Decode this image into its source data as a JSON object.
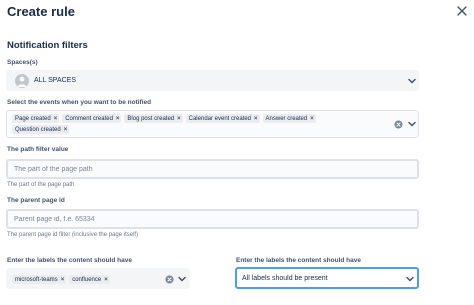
{
  "dialog": {
    "title": "Create rule"
  },
  "filters": {
    "section_title": "Notification filters",
    "spaces": {
      "label": "Spaces(s)",
      "value": "ALL SPACES"
    },
    "events": {
      "label": "Select the events when you want to be notified",
      "selected": [
        "Page created",
        "Comment created",
        "Blog post created",
        "Calendar event created",
        "Answer created",
        "Question created"
      ]
    },
    "path": {
      "label": "The path filter value",
      "placeholder": "The part of the page path",
      "helper": "The part of the page path"
    },
    "parent": {
      "label": "The parent page id",
      "placeholder": "Parent page id, f.e. 65334",
      "helper": "The parent page id filter (inclusive the page itself)"
    },
    "labels": {
      "label": "Enter the labels the content should have",
      "selected": [
        "microsoft-teams",
        "confluence"
      ]
    },
    "labels_mode": {
      "label": "Enter the labels the content should have",
      "value": "All labels should be present"
    }
  },
  "icons": {
    "close": "close-icon",
    "chevron": "chevron-down-icon",
    "clear": "clear-icon",
    "avatar": "space-avatar-icon",
    "tag_remove": "remove-tag-icon"
  },
  "colors": {
    "focus": "#4c9aff",
    "text": "#172b4d",
    "subtle": "#6b778c"
  }
}
